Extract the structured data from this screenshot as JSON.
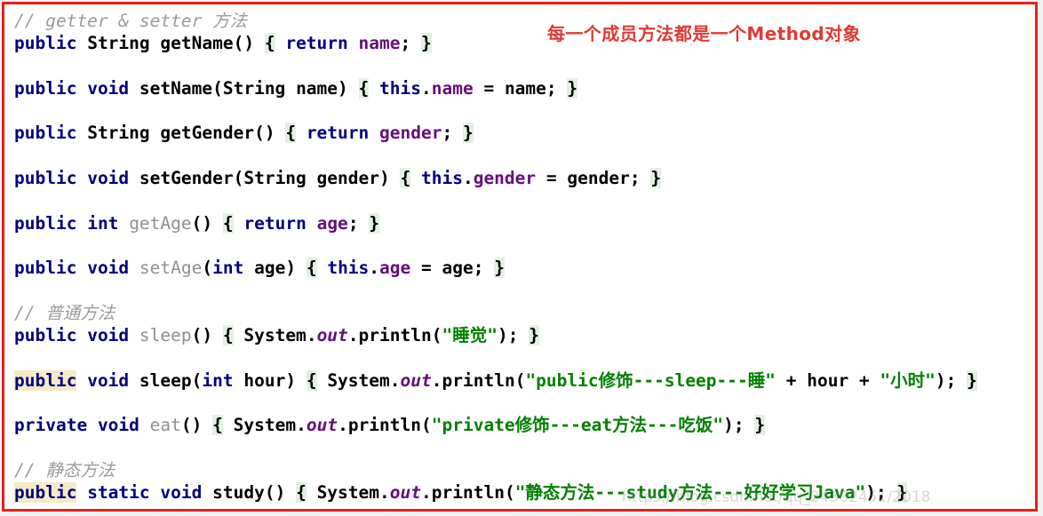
{
  "window": {
    "kind": "code-snippet-screenshot",
    "border_color": "#e8201f",
    "background": "#ffffff"
  },
  "theme": {
    "keyword_color": "#000080",
    "identifier_color": "#000000",
    "field_color": "#660e7a",
    "string_color": "#008000",
    "comment_color": "#9b9b9b",
    "unused_method_color": "#909090",
    "brace_match_highlight": "#e3f0e3",
    "caret_identifier_highlight": "#f6e9c6",
    "annotation_color": "#e03a32"
  },
  "annotation": {
    "text": "每一个成员方法都是一个Method对象"
  },
  "watermark": {
    "text": "https://blog.csdn.net/qq_24302451/2018"
  },
  "code": {
    "language": "Java",
    "lines": [
      {
        "index": 1,
        "kind": "comment",
        "text": "// getter & setter 方法"
      },
      {
        "index": 2,
        "kind": "method",
        "text": "public String getName() { return name; }"
      },
      {
        "index": 3,
        "kind": "blank",
        "text": ""
      },
      {
        "index": 4,
        "kind": "method",
        "text": "public void setName(String name) { this.name = name; }"
      },
      {
        "index": 5,
        "kind": "blank",
        "text": ""
      },
      {
        "index": 6,
        "kind": "method",
        "text": "public String getGender() { return gender; }"
      },
      {
        "index": 7,
        "kind": "blank",
        "text": ""
      },
      {
        "index": 8,
        "kind": "method",
        "text": "public void setGender(String gender) { this.gender = gender; }"
      },
      {
        "index": 9,
        "kind": "blank",
        "text": ""
      },
      {
        "index": 10,
        "kind": "method",
        "text": "public int getAge() { return age; }"
      },
      {
        "index": 11,
        "kind": "blank",
        "text": ""
      },
      {
        "index": 12,
        "kind": "method",
        "text": "public void setAge(int age) { this.age = age; }"
      },
      {
        "index": 13,
        "kind": "blank",
        "text": ""
      },
      {
        "index": 14,
        "kind": "comment",
        "text": "// 普通方法"
      },
      {
        "index": 15,
        "kind": "method",
        "text": "public void sleep() { System.out.println(\"睡觉\"); }"
      },
      {
        "index": 16,
        "kind": "blank",
        "text": ""
      },
      {
        "index": 17,
        "kind": "method",
        "text": "public void sleep(int hour) { System.out.println(\"public修饰---sleep---睡\" + hour + \"小时\"); }"
      },
      {
        "index": 18,
        "kind": "blank",
        "text": ""
      },
      {
        "index": 19,
        "kind": "method",
        "text": "private void eat() { System.out.println(\"private修饰---eat方法---吃饭\"); }"
      },
      {
        "index": 20,
        "kind": "blank",
        "text": ""
      },
      {
        "index": 21,
        "kind": "comment",
        "text": "// 静态方法"
      },
      {
        "index": 22,
        "kind": "method",
        "text": "public static void study() { System.out.println(\"静态方法---study方法---好好学习Java\"); }"
      }
    ],
    "tokens": {
      "comment_getter_setter": "// getter & setter 方法",
      "comment_ordinary": "// 普通方法",
      "comment_static": "// 静态方法",
      "kw_public": "public",
      "kw_private": "private",
      "kw_static": "static",
      "kw_void": "void",
      "kw_int": "int",
      "kw_return": "return",
      "kw_this": "this",
      "type_string": "String",
      "type_system": "System",
      "member_out": "out",
      "member_println": "println",
      "m_getName": "getName",
      "m_setName": "setName",
      "m_getGender": "getGender",
      "m_setGender": "setGender",
      "m_getAge": "getAge",
      "m_setAge": "setAge",
      "m_sleep": "sleep",
      "m_eat": "eat",
      "m_study": "study",
      "f_name": "name",
      "f_gender": "gender",
      "f_age": "age",
      "p_hour": "hour",
      "s_sleep_cn": "\"睡觉\"",
      "s_public_sleep": "\"public修饰---sleep---睡\"",
      "s_hours": "\"小时\"",
      "s_private_eat": "\"private修饰---eat方法---吃饭\"",
      "s_static_study": "\"静态方法---study方法---好好学习Java\""
    }
  }
}
